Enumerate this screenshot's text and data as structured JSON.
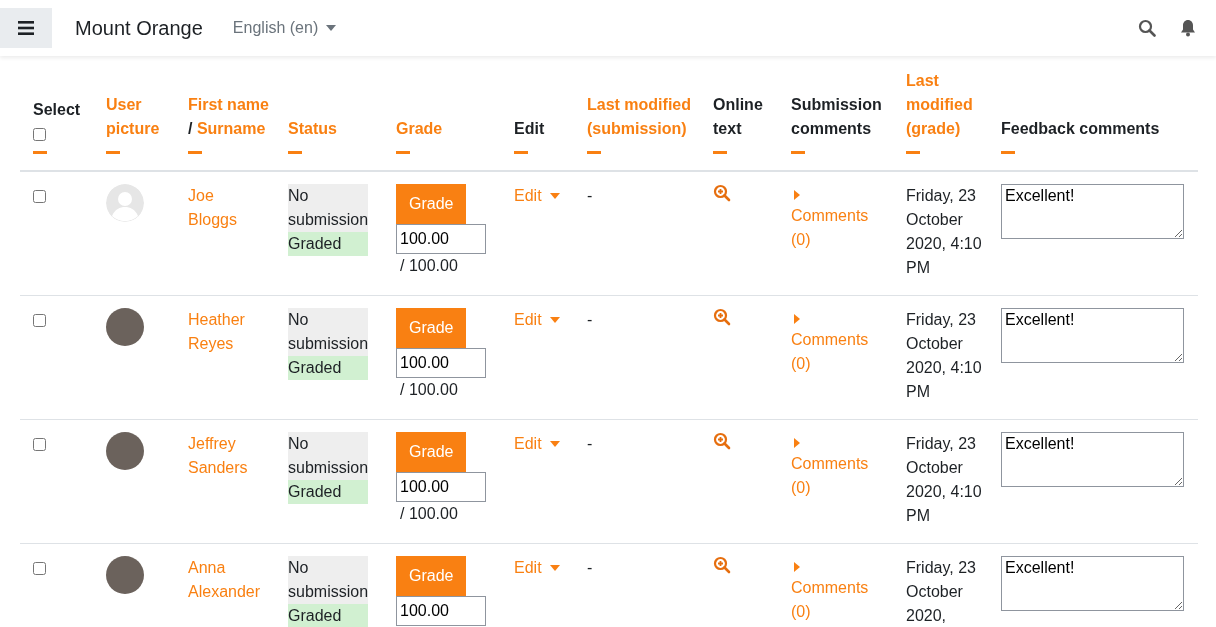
{
  "navbar": {
    "site_name": "Mount Orange",
    "language": "English (en)"
  },
  "table": {
    "select_all": {
      "checked": false
    },
    "columns": [
      {
        "kind": "select",
        "parts": [
          {
            "text": "Select",
            "link": false
          }
        ]
      },
      {
        "kind": "text",
        "parts": [
          {
            "text": "User picture",
            "link": true
          }
        ]
      },
      {
        "kind": "text",
        "parts": [
          {
            "text": "First name",
            "link": true
          },
          {
            "text": "/",
            "link": false
          },
          {
            "text": "Surname",
            "link": true
          }
        ]
      },
      {
        "kind": "text",
        "parts": [
          {
            "text": "Status",
            "link": true
          }
        ]
      },
      {
        "kind": "text",
        "parts": [
          {
            "text": "Grade",
            "link": true
          }
        ]
      },
      {
        "kind": "text",
        "parts": [
          {
            "text": "Edit",
            "link": false
          }
        ]
      },
      {
        "kind": "text",
        "parts": [
          {
            "text": "Last modified (submission)",
            "link": true
          }
        ]
      },
      {
        "kind": "text",
        "parts": [
          {
            "text": "Online text",
            "link": false
          }
        ]
      },
      {
        "kind": "text",
        "parts": [
          {
            "text": "Submission comments",
            "link": false
          }
        ]
      },
      {
        "kind": "text",
        "parts": [
          {
            "text": "Last modified (grade)",
            "link": true
          }
        ]
      },
      {
        "kind": "text",
        "parts": [
          {
            "text": "Feedback comments",
            "link": false
          }
        ]
      }
    ],
    "rows": [
      {
        "selected": false,
        "avatar": {
          "kind": "default"
        },
        "name": "Joe Bloggs",
        "status": [
          {
            "text": "No submission",
            "kind": "submission"
          },
          {
            "text": "Graded",
            "kind": "graded"
          }
        ],
        "grade_button": "Grade",
        "grade": "100.00",
        "max_grade": "/ 100.00",
        "edit": "Edit",
        "last_modified_submission": "-",
        "comments": "Comments (0)",
        "last_modified_grade": "Friday, 23 October 2020, 4:10 PM",
        "feedback": "Excellent!"
      },
      {
        "selected": false,
        "avatar": {
          "kind": "photo"
        },
        "name": "Heather Reyes",
        "status": [
          {
            "text": "No submission",
            "kind": "submission"
          },
          {
            "text": "Graded",
            "kind": "graded"
          }
        ],
        "grade_button": "Grade",
        "grade": "100.00",
        "max_grade": "/ 100.00",
        "edit": "Edit",
        "last_modified_submission": "-",
        "comments": "Comments (0)",
        "last_modified_grade": "Friday, 23 October 2020, 4:10 PM",
        "feedback": "Excellent!"
      },
      {
        "selected": false,
        "avatar": {
          "kind": "photo"
        },
        "name": "Jeffrey Sanders",
        "status": [
          {
            "text": "No submission",
            "kind": "submission"
          },
          {
            "text": "Graded",
            "kind": "graded"
          }
        ],
        "grade_button": "Grade",
        "grade": "100.00",
        "max_grade": "/ 100.00",
        "edit": "Edit",
        "last_modified_submission": "-",
        "comments": "Comments (0)",
        "last_modified_grade": "Friday, 23 October 2020, 4:10 PM",
        "feedback": "Excellent!"
      },
      {
        "selected": false,
        "avatar": {
          "kind": "photo"
        },
        "name": "Anna Alexander",
        "status": [
          {
            "text": "No submission",
            "kind": "submission"
          },
          {
            "text": "Graded",
            "kind": "graded"
          }
        ],
        "grade_button": "Grade",
        "grade": "100.00",
        "edit": "Edit",
        "last_modified_submission": "-",
        "comments": "Comments (0)",
        "last_modified_grade": "Friday, 23 October 2020,",
        "feedback": "Excellent!"
      }
    ]
  }
}
